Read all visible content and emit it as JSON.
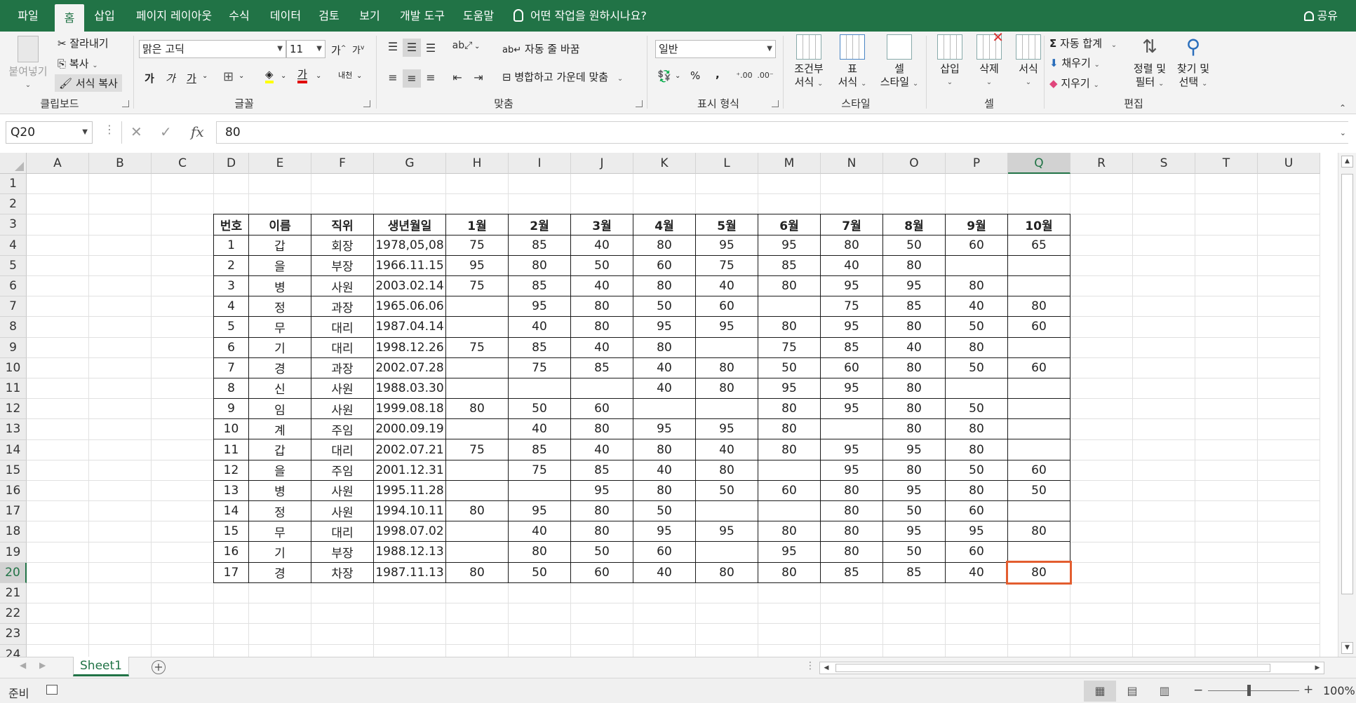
{
  "tabs": [
    "파일",
    "홈",
    "삽입",
    "페이지 레이아웃",
    "수식",
    "데이터",
    "검토",
    "보기",
    "개발 도구",
    "도움말"
  ],
  "active_tab": "홈",
  "tell_me": "어떤 작업을 원하시나요?",
  "share": "공유",
  "ribbon": {
    "clipboard": {
      "paste": "붙여넣기",
      "cut": "잘라내기",
      "copy": "복사",
      "format_painter": "서식 복사",
      "label": "클립보드"
    },
    "font": {
      "name": "맑은 고딕",
      "size": "11",
      "bold": "가",
      "italic": "가",
      "underline": "가",
      "grow": "가",
      "shrink": "가",
      "font_color_glyph": "가",
      "phonetic_glyph": "내천",
      "label": "글꼴"
    },
    "alignment": {
      "wrap": "자동 줄 바꿈",
      "merge": "병합하고 가운데 맞춤",
      "label": "맞춤"
    },
    "number": {
      "format": "일반",
      "percent": "%",
      "comma": ",",
      "label": "표시 형식"
    },
    "styles": {
      "conditional_line1": "조건부",
      "conditional_line2": "서식",
      "table_line1": "표",
      "table_line2": "서식",
      "cell_line1": "셀",
      "cell_line2": "스타일",
      "label": "스타일"
    },
    "cells": {
      "insert": "삽입",
      "delete": "삭제",
      "format": "서식",
      "label": "셀"
    },
    "editing": {
      "autosum": "자동 합계",
      "fill": "채우기",
      "clear": "지우기",
      "sort_line1": "정렬 및",
      "sort_line2": "필터",
      "find_line1": "찾기 및",
      "find_line2": "선택",
      "label": "편집"
    }
  },
  "formula_bar": {
    "name_box": "Q20",
    "cancel": "✕",
    "enter": "✓",
    "fx": "fx",
    "value": "80"
  },
  "columns": [
    "A",
    "B",
    "C",
    "D",
    "E",
    "F",
    "G",
    "H",
    "I",
    "J",
    "K",
    "L",
    "M",
    "N",
    "O",
    "P",
    "Q",
    "R",
    "S",
    "T",
    "U"
  ],
  "selected_column": "Q",
  "rows": [
    "1",
    "2",
    "3",
    "4",
    "5",
    "6",
    "7",
    "8",
    "9",
    "10",
    "11",
    "12",
    "13",
    "14",
    "15",
    "16",
    "17",
    "18",
    "19",
    "20",
    "21",
    "22",
    "23",
    "24"
  ],
  "selected_row": "20",
  "table": {
    "headers": [
      "번호",
      "이름",
      "직위",
      "생년월일",
      "1월",
      "2월",
      "3월",
      "4월",
      "5월",
      "6월",
      "7월",
      "8월",
      "9월",
      "10월"
    ],
    "rows": [
      [
        "1",
        "갑",
        "회장",
        "1978,05,08",
        "75",
        "85",
        "40",
        "80",
        "95",
        "95",
        "80",
        "50",
        "60",
        "65"
      ],
      [
        "2",
        "을",
        "부장",
        "1966.11.15",
        "95",
        "80",
        "50",
        "60",
        "75",
        "85",
        "40",
        "80",
        "",
        ""
      ],
      [
        "3",
        "병",
        "사원",
        "2003.02.14",
        "75",
        "85",
        "40",
        "80",
        "40",
        "80",
        "95",
        "95",
        "80",
        ""
      ],
      [
        "4",
        "정",
        "과장",
        "1965.06.06",
        "",
        "95",
        "80",
        "50",
        "60",
        "",
        "75",
        "85",
        "40",
        "80"
      ],
      [
        "5",
        "무",
        "대리",
        "1987.04.14",
        "",
        "40",
        "80",
        "95",
        "95",
        "80",
        "95",
        "80",
        "50",
        "60"
      ],
      [
        "6",
        "기",
        "대리",
        "1998.12.26",
        "75",
        "85",
        "40",
        "80",
        "",
        "75",
        "85",
        "40",
        "80",
        ""
      ],
      [
        "7",
        "경",
        "과장",
        "2002.07.28",
        "",
        "75",
        "85",
        "40",
        "80",
        "50",
        "60",
        "80",
        "50",
        "60"
      ],
      [
        "8",
        "신",
        "사원",
        "1988.03.30",
        "",
        "",
        "",
        "40",
        "80",
        "95",
        "95",
        "80",
        "",
        ""
      ],
      [
        "9",
        "임",
        "사원",
        "1999.08.18",
        "80",
        "50",
        "60",
        "",
        "",
        "80",
        "95",
        "80",
        "50",
        ""
      ],
      [
        "10",
        "계",
        "주임",
        "2000.09.19",
        "",
        "40",
        "80",
        "95",
        "95",
        "80",
        "",
        "80",
        "80",
        ""
      ],
      [
        "11",
        "갑",
        "대리",
        "2002.07.21",
        "75",
        "85",
        "40",
        "80",
        "40",
        "80",
        "95",
        "95",
        "80",
        ""
      ],
      [
        "12",
        "을",
        "주임",
        "2001.12.31",
        "",
        "75",
        "85",
        "40",
        "80",
        "",
        "95",
        "80",
        "50",
        "60"
      ],
      [
        "13",
        "병",
        "사원",
        "1995.11.28",
        "",
        "",
        "95",
        "80",
        "50",
        "60",
        "80",
        "95",
        "80",
        "50"
      ],
      [
        "14",
        "정",
        "사원",
        "1994.10.11",
        "80",
        "95",
        "80",
        "50",
        "",
        "",
        "80",
        "50",
        "60",
        ""
      ],
      [
        "15",
        "무",
        "대리",
        "1998.07.02",
        "",
        "40",
        "80",
        "95",
        "95",
        "80",
        "80",
        "95",
        "95",
        "80"
      ],
      [
        "16",
        "기",
        "부장",
        "1988.12.13",
        "",
        "80",
        "50",
        "60",
        "",
        "95",
        "80",
        "50",
        "60",
        ""
      ],
      [
        "17",
        "경",
        "차장",
        "1987.11.13",
        "80",
        "50",
        "60",
        "40",
        "80",
        "80",
        "85",
        "85",
        "40",
        "80"
      ]
    ]
  },
  "sheet_tab": "Sheet1",
  "add_sheet": "+",
  "status": {
    "ready": "준비",
    "zoom": "100%",
    "zoom_minus": "−",
    "zoom_plus": "+"
  },
  "colors": {
    "accent": "#217346",
    "selection": "#e35d2f"
  }
}
